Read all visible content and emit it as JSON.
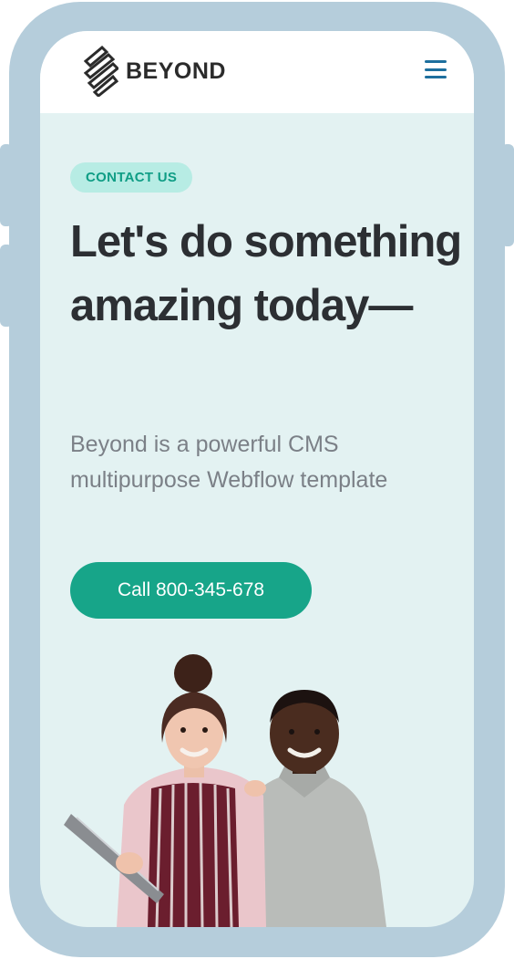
{
  "brand": {
    "name": "BEYOND"
  },
  "nav": {
    "menu_icon": "hamburger-menu-icon"
  },
  "hero": {
    "badge": "CONTACT US",
    "headline": "Let's do something amazing today—",
    "subtitle": "Beyond is a powerful CMS multipurpose Webflow template",
    "cta_label": "Call 800-345-678"
  },
  "colors": {
    "frame": "#b5cddb",
    "screen_bg": "#e3f2f2",
    "accent": "#17a589",
    "badge_bg": "#b7ece4",
    "badge_text": "#0f9d85",
    "menu_icon": "#1d6f9e",
    "heading": "#2c2f33",
    "body_text": "#7b8087"
  }
}
